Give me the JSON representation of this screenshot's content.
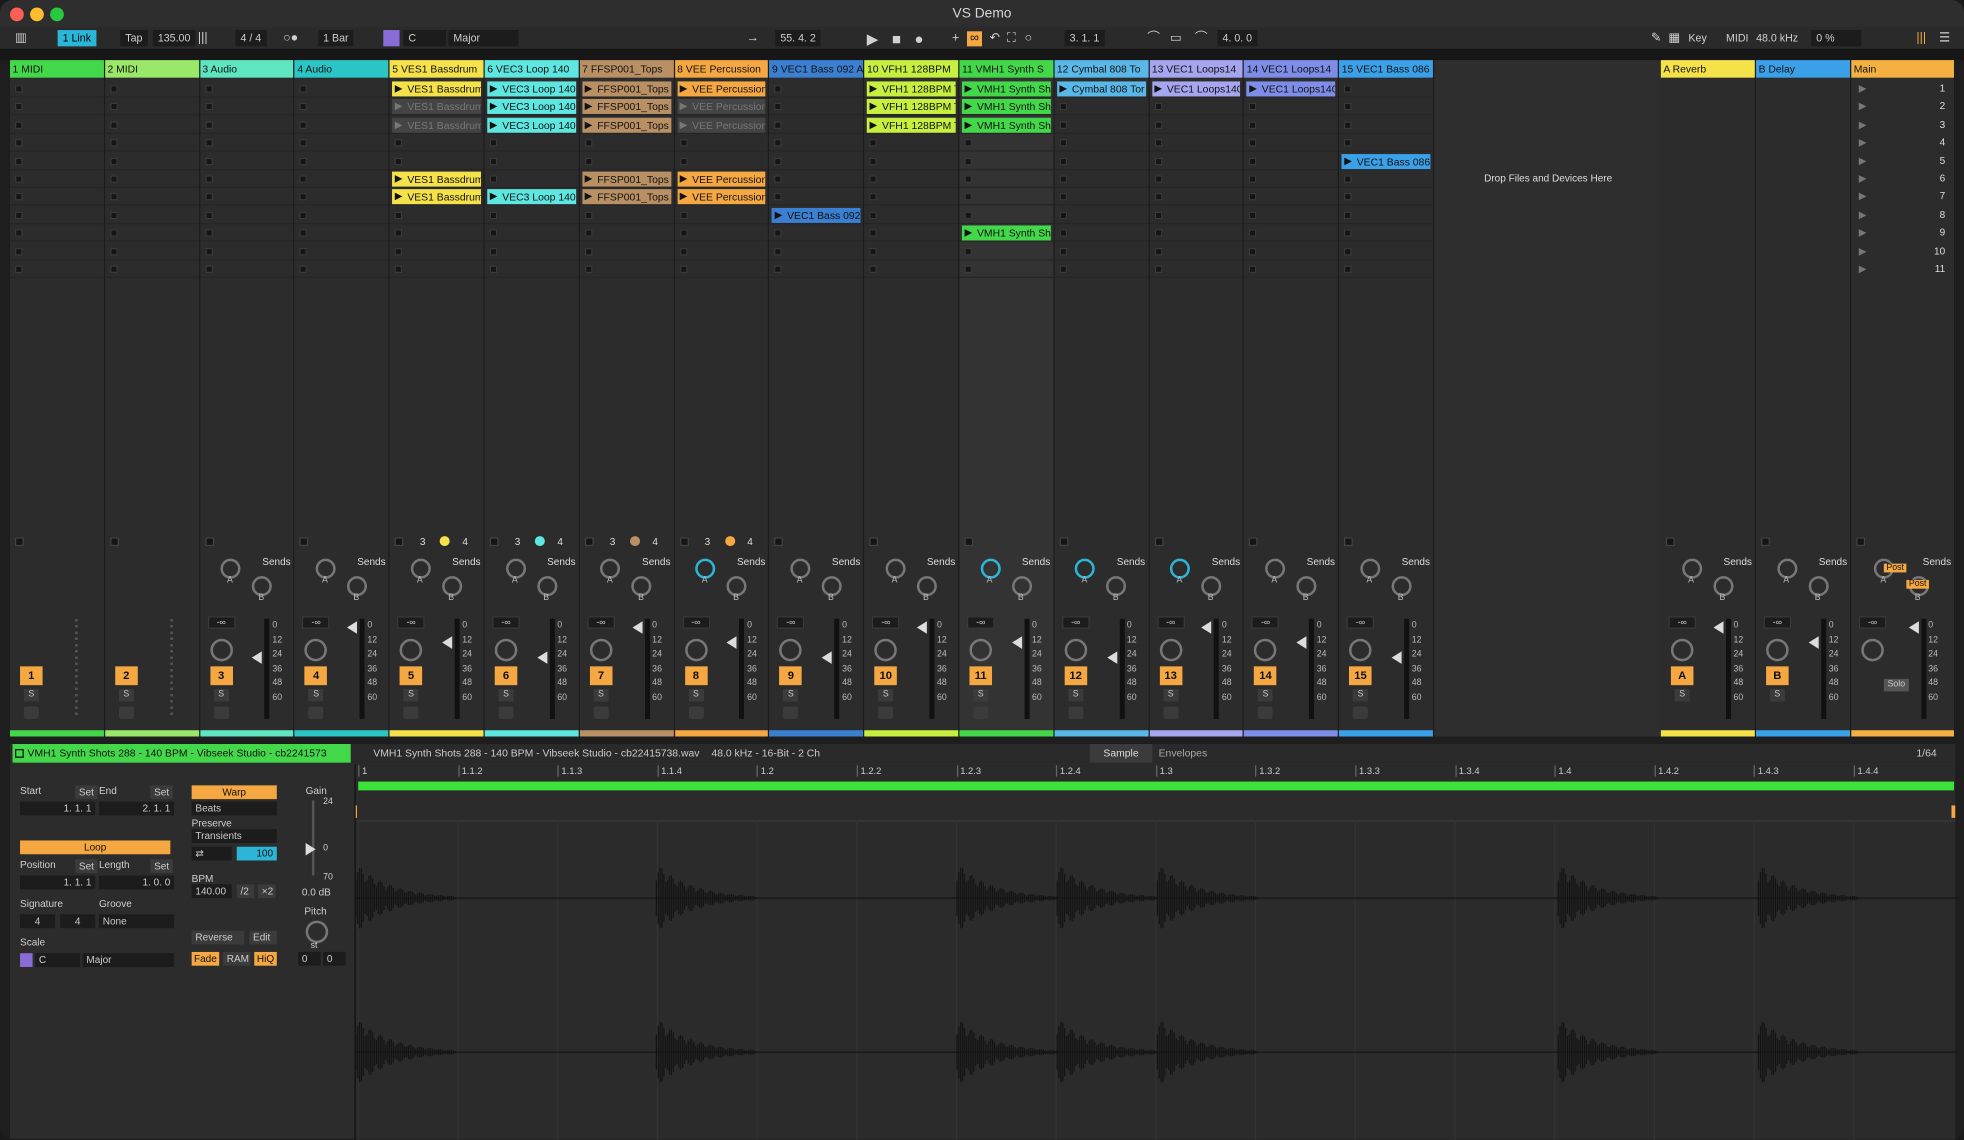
{
  "window": {
    "title": "VS Demo"
  },
  "toolbar": {
    "link": "1 Link",
    "tap": "Tap",
    "tempo": "135.00",
    "signature": "4 / 4",
    "quantize": "1 Bar",
    "key": "C",
    "scale": "Major",
    "position": "55.  4.  2",
    "loop_start": "3.  1.  1",
    "loop_length": "4.  0.  0",
    "key_label": "Key",
    "midi_label": "MIDI",
    "sample_rate": "48.0 kHz",
    "cpu": "0 %"
  },
  "colors": {
    "yellow": "#f5e14a",
    "cyan": "#5ee6e0",
    "brown": "#b89064",
    "orange": "#f5a742",
    "blue": "#3a7fd0",
    "lime": "#c6ef3f",
    "green": "#43d84a",
    "lblue": "#5ab8e8",
    "lavender": "#a6a6f0",
    "periwinkle": "#7e8ee8",
    "mint": "#7fe8c8"
  },
  "tracks": [
    {
      "name": "1 MIDI",
      "color": "#43d84a",
      "num": "1",
      "clips": []
    },
    {
      "name": "2 MIDI",
      "color": "#9ae86a",
      "num": "2",
      "clips": []
    },
    {
      "name": "3 Audio",
      "color": "#5ee6c0",
      "num": "3",
      "clips": []
    },
    {
      "name": "4 Audio",
      "color": "#2bc5c5",
      "num": "4",
      "clips": []
    },
    {
      "name": "5 VES1 Bassdrum",
      "color": "#f5e14a",
      "num": "5",
      "sends": [
        "3",
        "4"
      ],
      "clips": [
        {
          "row": 0,
          "name": "VES1 Bassdrum"
        },
        {
          "row": 1,
          "name": "VES1 Bassdrum",
          "dim": true
        },
        {
          "row": 2,
          "name": "VES1 Bassdrum",
          "dim": true
        },
        {
          "row": 5,
          "name": "VES1 Bassdrum"
        },
        {
          "row": 6,
          "name": "VES1 Bassdrum"
        }
      ]
    },
    {
      "name": "6 VEC3 Loop 140",
      "color": "#5ee6e0",
      "num": "6",
      "sends": [
        "3",
        "4"
      ],
      "clips": [
        {
          "row": 0,
          "name": "VEC3 Loop 140"
        },
        {
          "row": 1,
          "name": "VEC3 Loop 140"
        },
        {
          "row": 2,
          "name": "VEC3 Loop 140"
        },
        {
          "row": 6,
          "name": "VEC3 Loop 140"
        }
      ]
    },
    {
      "name": "7 FFSP001_Tops",
      "color": "#b89064",
      "num": "7",
      "sends": [
        "3",
        "4"
      ],
      "clips": [
        {
          "row": 0,
          "name": "FFSP001_Tops"
        },
        {
          "row": 1,
          "name": "FFSP001_Tops"
        },
        {
          "row": 2,
          "name": "FFSP001_Tops"
        },
        {
          "row": 5,
          "name": "FFSP001_Tops"
        },
        {
          "row": 6,
          "name": "FFSP001_Tops"
        }
      ]
    },
    {
      "name": "8 VEE Percussion",
      "color": "#f5a742",
      "num": "8",
      "sends": [
        "3",
        "4"
      ],
      "clips": [
        {
          "row": 0,
          "name": "VEE Percussion"
        },
        {
          "row": 1,
          "name": "VEE Percussion",
          "dim": true
        },
        {
          "row": 2,
          "name": "VEE Percussion",
          "dim": true
        },
        {
          "row": 5,
          "name": "VEE Percussion"
        },
        {
          "row": 6,
          "name": "VEE Percussion"
        }
      ]
    },
    {
      "name": "9 VEC1 Bass 092 A",
      "color": "#3a7fd0",
      "num": "9",
      "clips": [
        {
          "row": 7,
          "name": "VEC1 Bass 092"
        }
      ]
    },
    {
      "name": "10 VFH1 128BPM",
      "color": "#c6ef3f",
      "num": "10",
      "clips": [
        {
          "row": 0,
          "name": "VFH1 128BPM T"
        },
        {
          "row": 1,
          "name": "VFH1 128BPM T"
        },
        {
          "row": 2,
          "name": "VFH1 128BPM T"
        }
      ]
    },
    {
      "name": "11 VMH1 Synth S",
      "color": "#43d84a",
      "num": "11",
      "clips": [
        {
          "row": 0,
          "name": "VMH1 Synth Sh"
        },
        {
          "row": 1,
          "name": "VMH1 Synth Sh"
        },
        {
          "row": 2,
          "name": "VMH1 Synth Sh"
        },
        {
          "row": 8,
          "name": "VMH1 Synth Sh"
        }
      ]
    },
    {
      "name": "12 Cymbal 808 To",
      "color": "#5ab8e8",
      "num": "12",
      "clips": [
        {
          "row": 0,
          "name": "Cymbal 808 Tor"
        }
      ]
    },
    {
      "name": "13 VEC1 Loops14",
      "color": "#a6a6f0",
      "num": "13",
      "clips": [
        {
          "row": 0,
          "name": "VEC1 Loops140"
        }
      ]
    },
    {
      "name": "14 VEC1 Loops14",
      "color": "#7e8ee8",
      "num": "14",
      "clips": [
        {
          "row": 0,
          "name": "VEC1 Loops140"
        }
      ]
    },
    {
      "name": "15 VEC1 Bass 086",
      "color": "#3aa0e8",
      "num": "15",
      "clips": [
        {
          "row": 4,
          "name": "VEC1 Bass 086"
        }
      ]
    }
  ],
  "drop_text": "Drop Files and Devices Here",
  "returns": [
    {
      "name": "A Reverb",
      "color": "#f5e14a",
      "num": "A"
    },
    {
      "name": "B Delay",
      "color": "#3aa0e8",
      "num": "B"
    }
  ],
  "main": {
    "name": "Main",
    "color": "#f5b042",
    "solo": "Solo",
    "post": "Post"
  },
  "scenes": [
    "1",
    "2",
    "3",
    "4",
    "5",
    "6",
    "7",
    "8",
    "9",
    "10",
    "11"
  ],
  "mixer": {
    "sends": "Sends",
    "send_a": "A",
    "send_b": "B",
    "vol": "-∞",
    "solo": "S",
    "db_marks": [
      "0",
      "12",
      "24",
      "36",
      "48",
      "60"
    ]
  },
  "detail": {
    "clip_name": "VMH1 Synth Shots 288 - 140 BPM - Vibseek Studio - cb2241573",
    "file_name": "VMH1 Synth Shots 288 - 140 BPM - Vibseek Studio - cb22415738.wav",
    "file_info": "48.0 kHz - 16-Bit - 2 Ch",
    "tab_sample": "Sample",
    "tab_envelopes": "Envelopes",
    "grid": "1/64",
    "start_label": "Start",
    "end_label": "End",
    "set": "Set",
    "start_val": "1.   1.   1",
    "end_val": "2.   1.   1",
    "loop": "Loop",
    "position_label": "Position",
    "length_label": "Length",
    "position_val": "1.   1.   1",
    "length_val": "1.   0.   0",
    "signature_label": "Signature",
    "groove_label": "Groove",
    "sig_num": "4",
    "sig_den": "4",
    "groove_val": "None",
    "scale_label": "Scale",
    "scale_key": "C",
    "scale_mode": "Major",
    "warp": "Warp",
    "warp_mode": "Beats",
    "preserve": "Preserve",
    "transients": "Transients",
    "beats_amt": "100",
    "bpm_label": "BPM",
    "bpm_val": "140.00",
    "half": "/2",
    "double": "×2",
    "reverse": "Reverse",
    "edit": "Edit",
    "fade": "Fade",
    "ram": "RAM",
    "hiq": "HiQ",
    "gain_label": "Gain",
    "gain_top": "24",
    "gain_zero": "0",
    "gain_bottom": "70",
    "gain_val": "0.0 dB",
    "pitch_label": "Pitch",
    "pitch_unit": "st",
    "pitch_val": "0",
    "detune_val": "0"
  },
  "ruler": [
    "1",
    "1.1.2",
    "1.1.3",
    "1.1.4",
    "1.2",
    "1.2.2",
    "1.2.3",
    "1.2.4",
    "1.3",
    "1.3.2",
    "1.3.3",
    "1.3.4",
    "1.4",
    "1.4.2",
    "1.4.3",
    "1.4.4"
  ]
}
